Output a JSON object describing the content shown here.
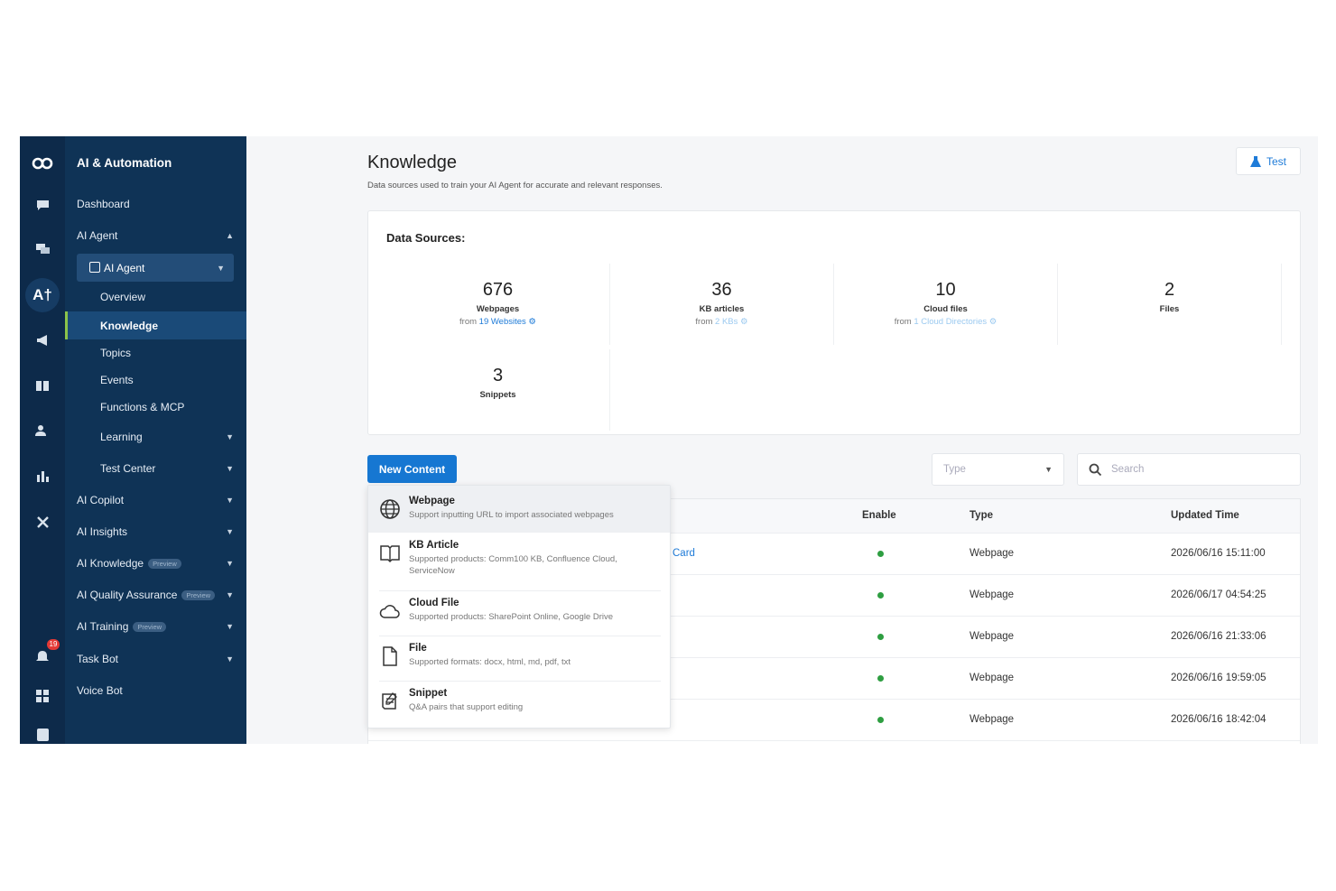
{
  "sidebar": {
    "title": "AI & Automation",
    "agent_select": "AI Agent",
    "notification_count": "19",
    "items": {
      "dashboard": "Dashboard",
      "ai_agent": "AI Agent",
      "overview": "Overview",
      "knowledge": "Knowledge",
      "topics": "Topics",
      "events": "Events",
      "functions": "Functions & MCP",
      "learning": "Learning",
      "test_center": "Test Center",
      "ai_copilot": "AI Copilot",
      "ai_insights": "AI Insights",
      "ai_knowledge": "AI Knowledge",
      "ai_quality": "AI Quality Assurance",
      "ai_training": "AI Training",
      "task_bot": "Task Bot",
      "voice_bot": "Voice Bot"
    },
    "preview_badge": "Preview"
  },
  "header": {
    "title": "Knowledge",
    "subtitle": "Data sources used to train your AI Agent for accurate and relevant responses.",
    "test_label": "Test"
  },
  "data_sources": {
    "title": "Data Sources:",
    "webpages": {
      "count": "676",
      "label": "Webpages",
      "from": "from ",
      "link": "19 Websites"
    },
    "kb_articles": {
      "count": "36",
      "label": "KB articles",
      "from": "from ",
      "link": "2 KBs"
    },
    "cloud_files": {
      "count": "10",
      "label": "Cloud files",
      "from": "from ",
      "link": "1 Cloud Directories"
    },
    "files": {
      "count": "2",
      "label": "Files"
    },
    "snippets": {
      "count": "3",
      "label": "Snippets"
    }
  },
  "toolbar": {
    "new_content": "New Content",
    "type_placeholder": "Type",
    "search_placeholder": "Search"
  },
  "table": {
    "headers": {
      "enable": "Enable",
      "type": "Type",
      "updated": "Updated Time"
    },
    "rows": [
      {
        "name_fragment": "Card",
        "type": "Webpage",
        "updated": "2026/06/16 15:11:00"
      },
      {
        "name_fragment": "",
        "type": "Webpage",
        "updated": "2026/06/17 04:54:25"
      },
      {
        "name_fragment": "",
        "type": "Webpage",
        "updated": "2026/06/16 21:33:06"
      },
      {
        "name_fragment": "",
        "type": "Webpage",
        "updated": "2026/06/16 19:59:05"
      },
      {
        "name_fragment": "",
        "type": "Webpage",
        "updated": "2026/06/16 18:42:04"
      }
    ]
  },
  "menu": {
    "webpage": {
      "title": "Webpage",
      "desc": "Support inputting URL to import associated webpages"
    },
    "kb_article": {
      "title": "KB Article",
      "desc": "Supported products: Comm100 KB, Confluence Cloud, ServiceNow"
    },
    "cloud_file": {
      "title": "Cloud File",
      "desc": "Supported products: SharePoint Online, Google Drive"
    },
    "file": {
      "title": "File",
      "desc": "Supported formats: docx, html, md, pdf, txt"
    },
    "snippet": {
      "title": "Snippet",
      "desc": "Q&A pairs that support editing"
    }
  },
  "colors": {
    "rail": "#0d2a4a",
    "sidebar": "#0f3356",
    "accent": "#1677d2",
    "active_indicator": "#8bc34a",
    "enabled_dot": "#2e9e41"
  }
}
